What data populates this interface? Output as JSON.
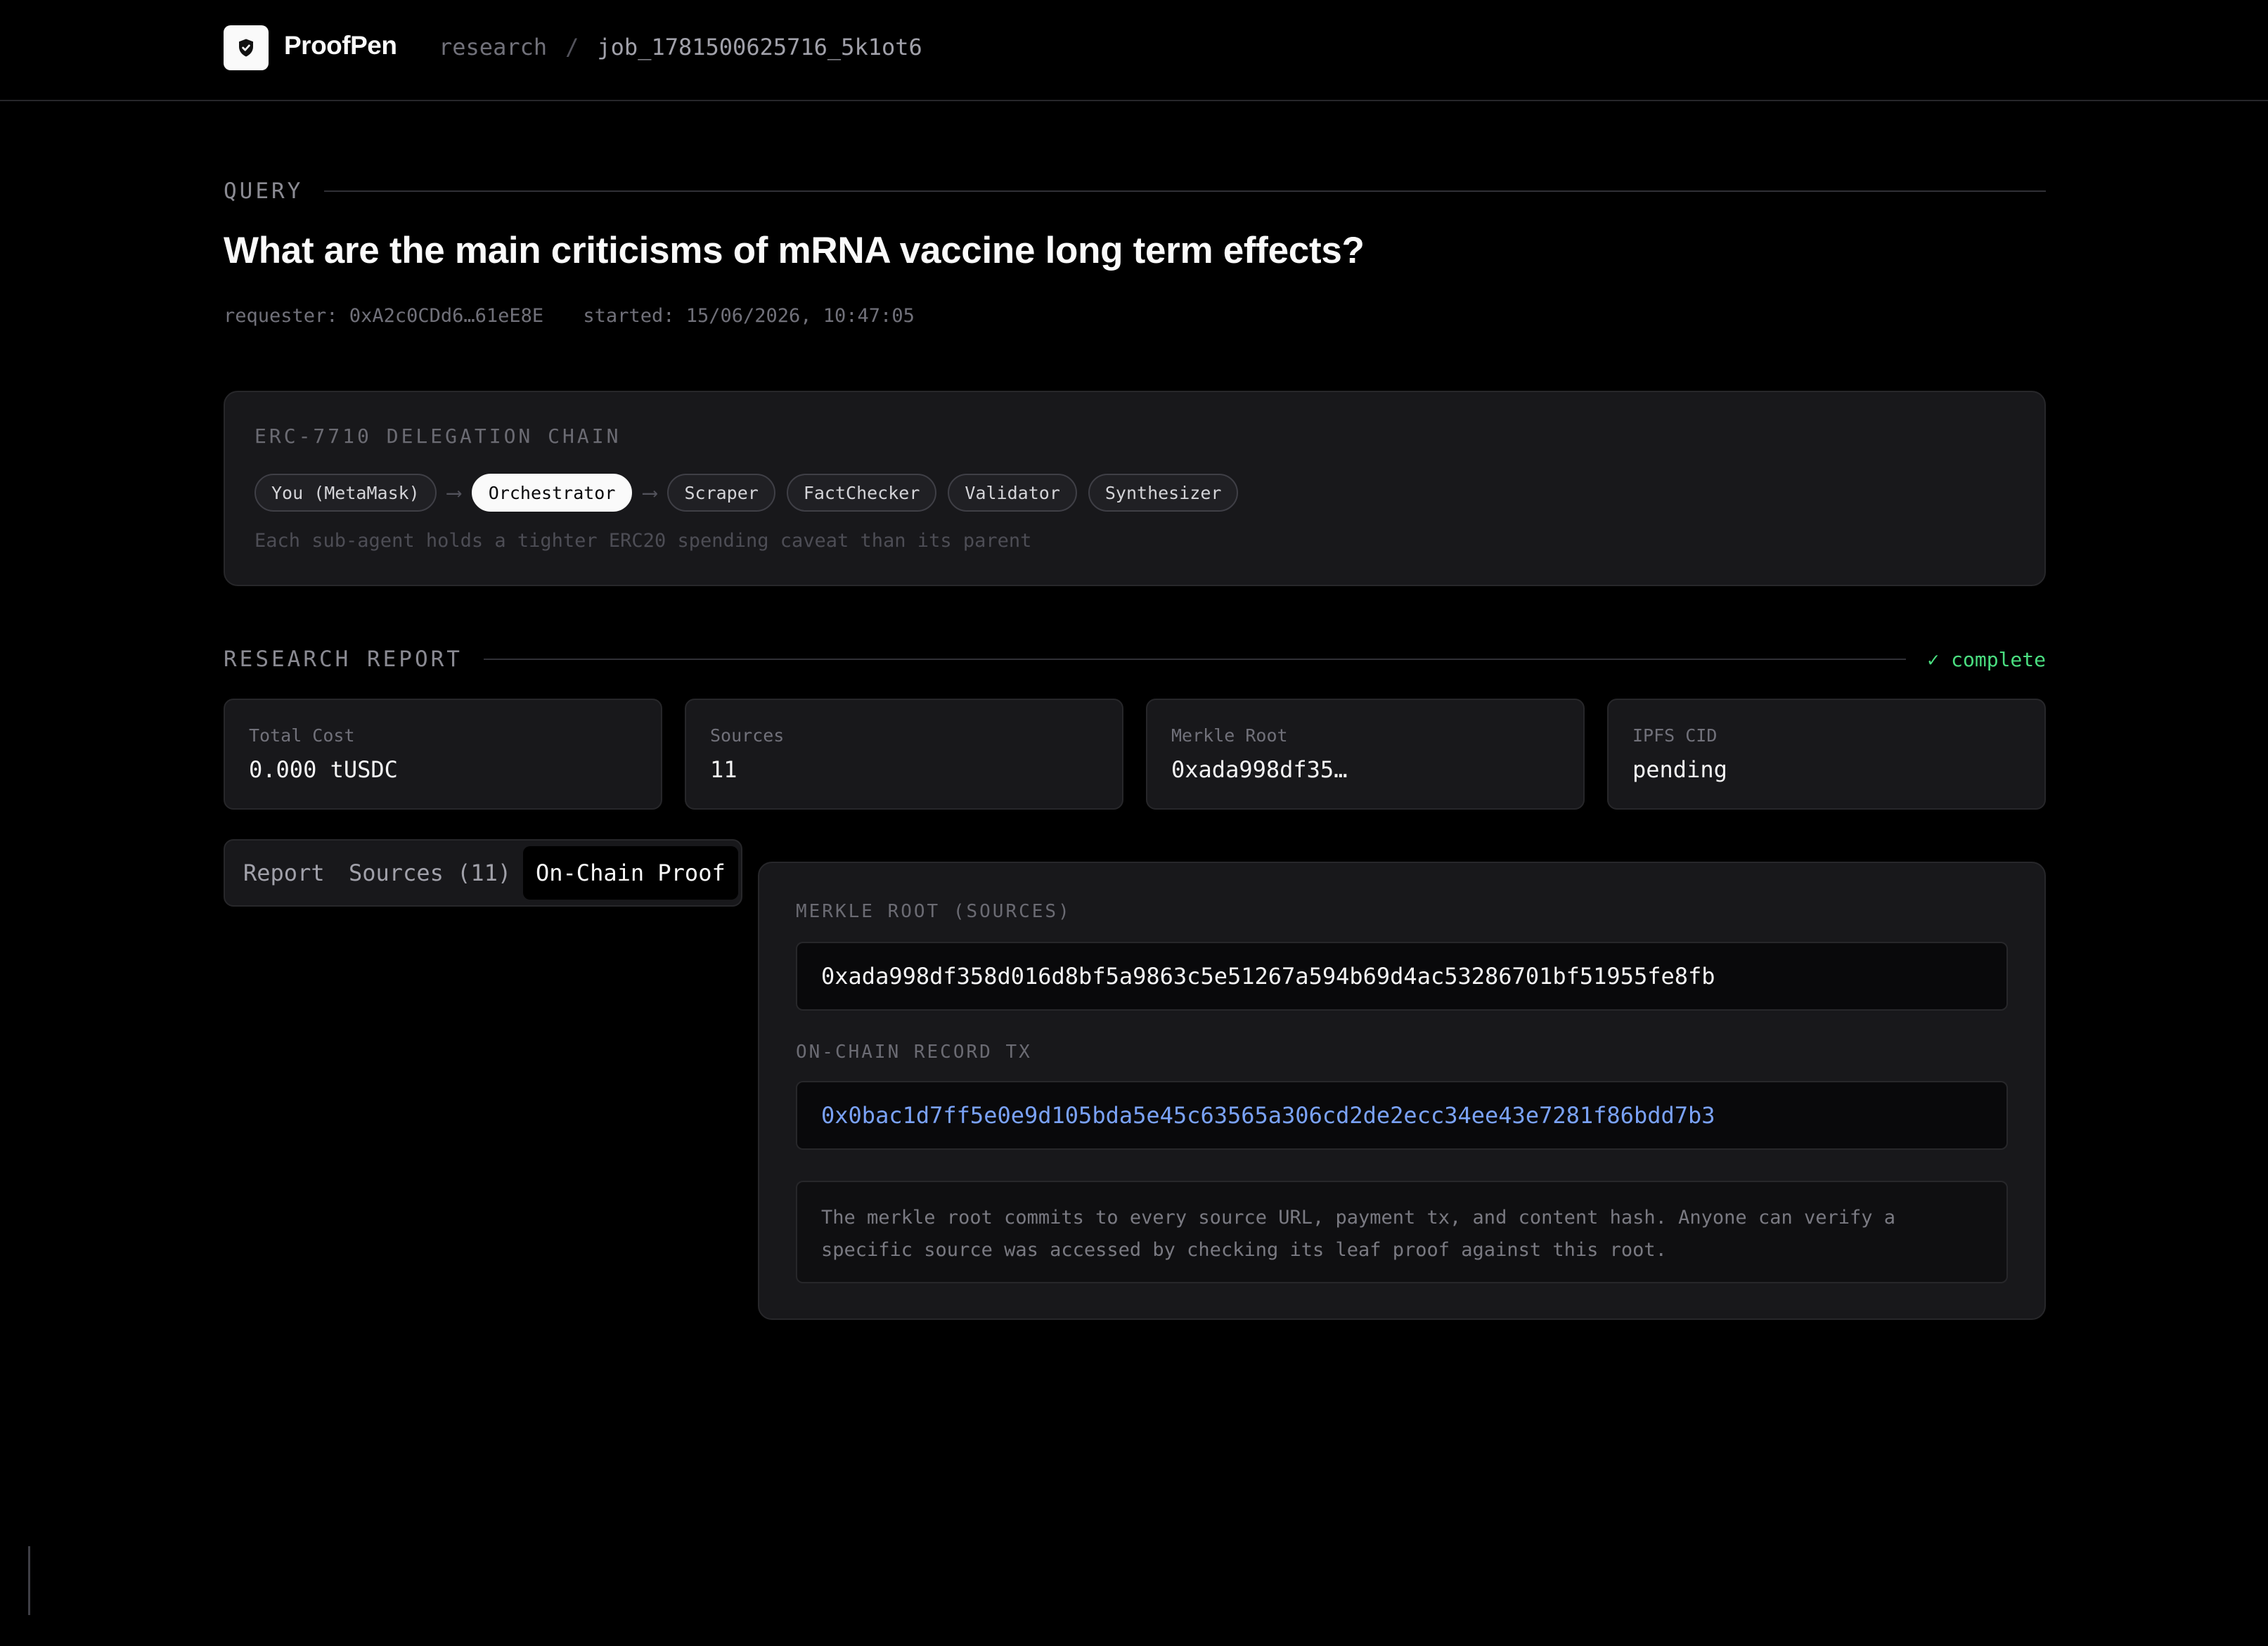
{
  "header": {
    "brand": "ProofPen",
    "breadcrumb_root": "research",
    "breadcrumb_sep": "/",
    "breadcrumb_job": "job_1781500625716_5k1ot6"
  },
  "query": {
    "section_label": "QUERY",
    "question": "What are the main criticisms of mRNA vaccine long term effects?",
    "requester": "requester: 0xA2c0CDd6…61eE8E",
    "started": "started: 15/06/2026, 10:47:05"
  },
  "delegation": {
    "title": "ERC-7710 DELEGATION CHAIN",
    "agents": [
      "You (MetaMask)",
      "Orchestrator",
      "Scraper",
      "FactChecker",
      "Validator",
      "Synthesizer"
    ],
    "arrow": "⟶",
    "note": "Each sub-agent holds a tighter ERC20 spending caveat than its parent"
  },
  "report": {
    "section_label": "RESEARCH REPORT",
    "status": "✓ complete",
    "stats": [
      {
        "key": "Total Cost",
        "value": "0.000 tUSDC"
      },
      {
        "key": "Sources",
        "value": "11"
      },
      {
        "key": "Merkle Root",
        "value": "0xada998df35…"
      },
      {
        "key": "IPFS CID",
        "value": "pending"
      }
    ],
    "tabs": [
      {
        "label": "Report"
      },
      {
        "label": "Sources (11)"
      },
      {
        "label": "On-Chain Proof",
        "active": true
      }
    ]
  },
  "proof": {
    "merkle_label": "MERKLE ROOT (SOURCES)",
    "merkle_value": "0xada998df358d016d8bf5a9863c5e51267a594b69d4ac53286701bf51955fe8fb",
    "tx_label": "ON-CHAIN RECORD TX",
    "tx_value": "0x0bac1d7ff5e0e9d105bda5e45c63565a306cd2de2ecc34ee43e7281f86bdd7b3",
    "note": "The merkle root commits to every source URL, payment tx, and content hash. Anyone can verify a specific source was accessed by checking its leaf proof against this root."
  },
  "colors": {
    "background": "#000000",
    "card": "#18181b",
    "accent_link": "#7aa2f7",
    "status_green": "#4ade80"
  }
}
